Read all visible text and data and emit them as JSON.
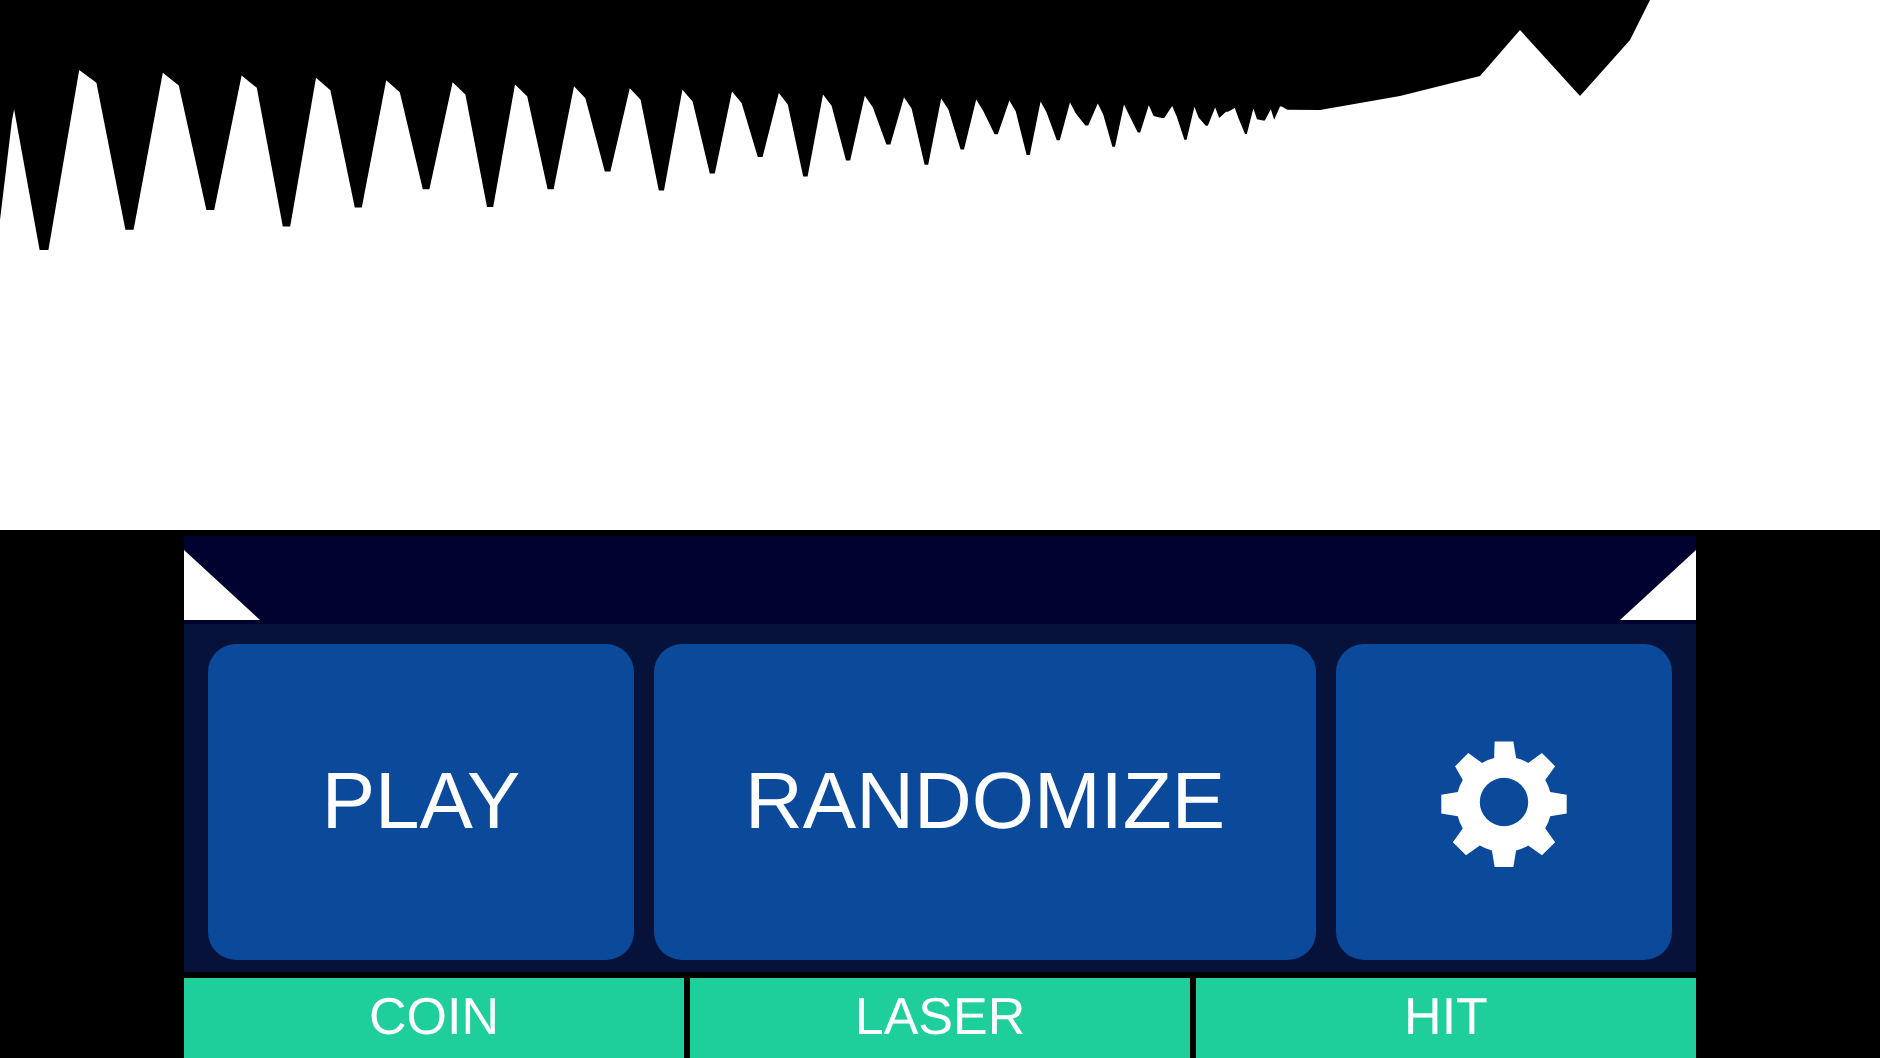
{
  "controls": [
    {
      "kind": "text",
      "label": "PLAY"
    },
    {
      "kind": "text",
      "label": "RANDOMIZE"
    },
    {
      "kind": "settings"
    }
  ],
  "presets": [
    {
      "label": "COIN"
    },
    {
      "label": "LASER"
    },
    {
      "label": "HIT"
    }
  ]
}
